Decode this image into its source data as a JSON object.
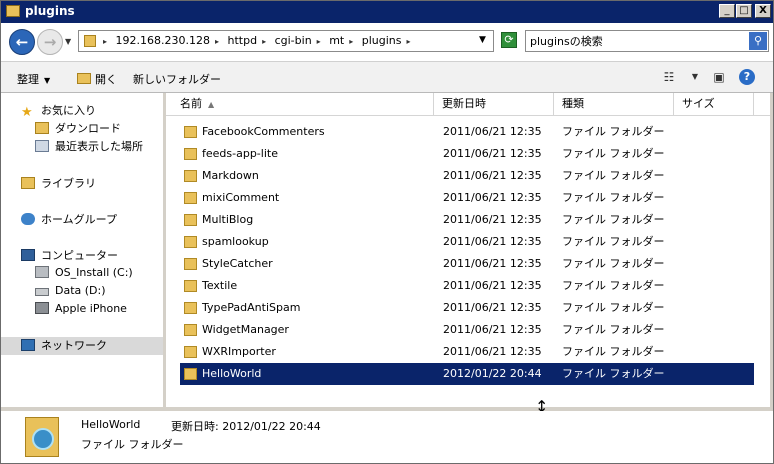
{
  "window": {
    "title": "plugins",
    "min": "_",
    "max": "□",
    "close": "X"
  },
  "address": {
    "crumbs": [
      "192.168.230.128",
      "httpd",
      "cgi-bin",
      "mt",
      "plugins"
    ],
    "search_placeholder": "pluginsの検索"
  },
  "toolbar": {
    "organize": "整理",
    "open": "開く",
    "new_folder": "新しいフォルダー"
  },
  "nav": {
    "favorites": "お気に入り",
    "downloads": "ダウンロード",
    "recent": "最近表示した場所",
    "libraries": "ライブラリ",
    "homegroup": "ホームグループ",
    "computer": "コンピューター",
    "drive_c": "OS_Install (C:)",
    "drive_d": "Data (D:)",
    "iphone": "Apple iPhone",
    "network": "ネットワーク"
  },
  "columns": {
    "name": "名前",
    "modified": "更新日時",
    "type": "種類",
    "size": "サイズ"
  },
  "files": [
    {
      "name": "FacebookCommenters",
      "date": "2011/06/21 12:35",
      "type": "ファイル フォルダー"
    },
    {
      "name": "feeds-app-lite",
      "date": "2011/06/21 12:35",
      "type": "ファイル フォルダー"
    },
    {
      "name": "Markdown",
      "date": "2011/06/21 12:35",
      "type": "ファイル フォルダー"
    },
    {
      "name": "mixiComment",
      "date": "2011/06/21 12:35",
      "type": "ファイル フォルダー"
    },
    {
      "name": "MultiBlog",
      "date": "2011/06/21 12:35",
      "type": "ファイル フォルダー"
    },
    {
      "name": "spamlookup",
      "date": "2011/06/21 12:35",
      "type": "ファイル フォルダー"
    },
    {
      "name": "StyleCatcher",
      "date": "2011/06/21 12:35",
      "type": "ファイル フォルダー"
    },
    {
      "name": "Textile",
      "date": "2011/06/21 12:35",
      "type": "ファイル フォルダー"
    },
    {
      "name": "TypePadAntiSpam",
      "date": "2011/06/21 12:35",
      "type": "ファイル フォルダー"
    },
    {
      "name": "WidgetManager",
      "date": "2011/06/21 12:35",
      "type": "ファイル フォルダー"
    },
    {
      "name": "WXRImporter",
      "date": "2011/06/21 12:35",
      "type": "ファイル フォルダー"
    },
    {
      "name": "HelloWorld",
      "date": "2012/01/22 20:44",
      "type": "ファイル フォルダー",
      "selected": true
    }
  ],
  "details": {
    "name": "HelloWorld",
    "modified": "更新日時: 2012/01/22 20:44",
    "type": "ファイル フォルダー"
  },
  "icons": {
    "back": "back-arrow-icon",
    "forward": "forward-arrow-icon",
    "refresh": "refresh-icon",
    "search": "search-icon",
    "help": "help-icon",
    "views": "views-icon",
    "preview": "preview-pane-icon"
  }
}
